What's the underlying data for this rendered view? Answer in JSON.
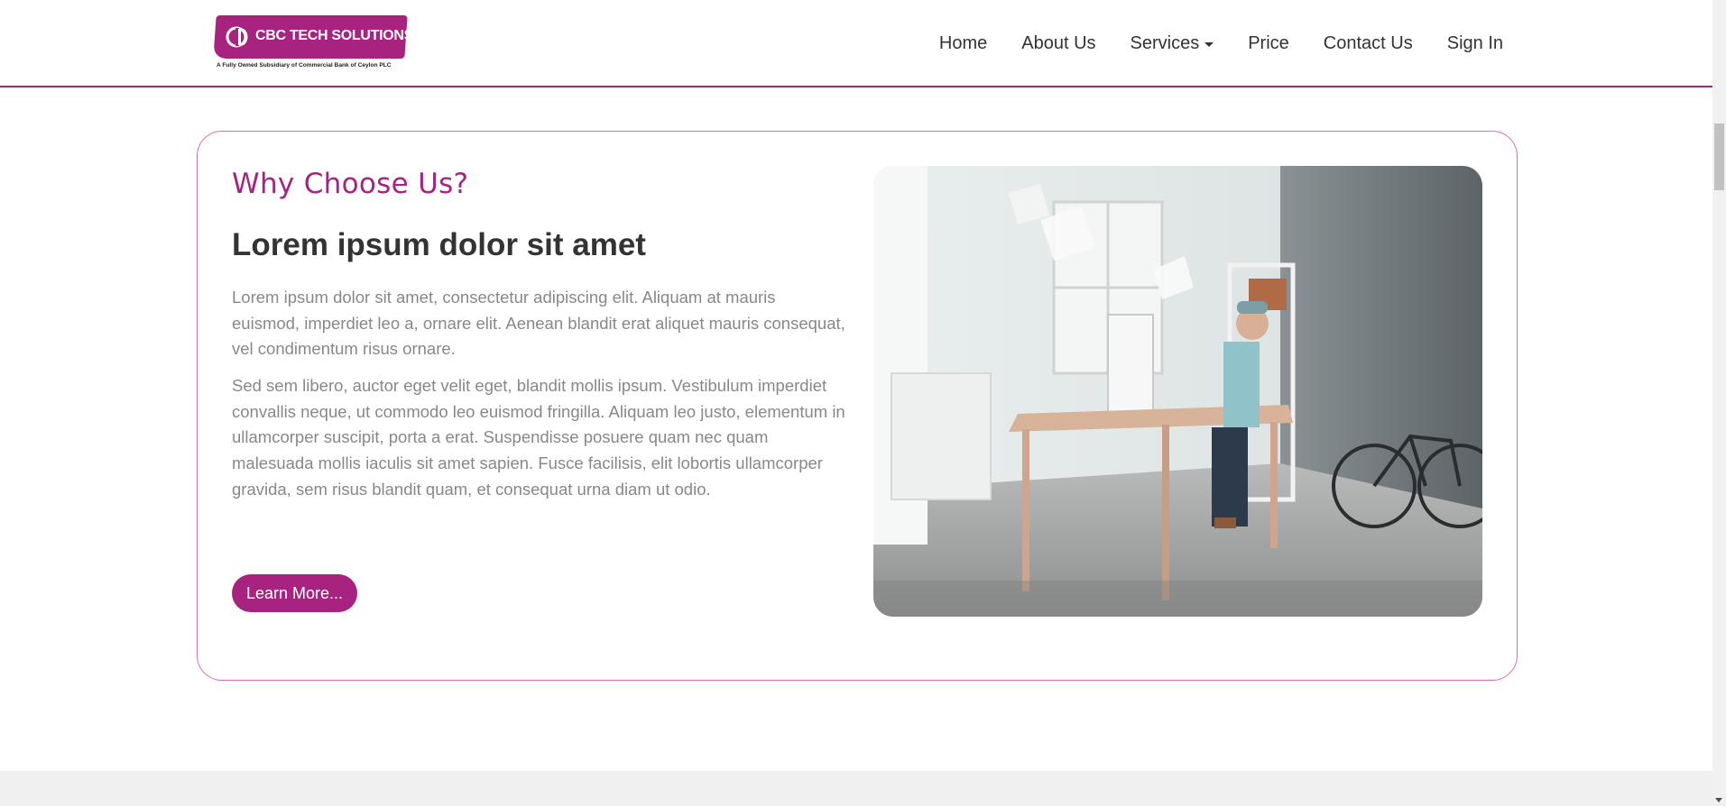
{
  "header": {
    "logo": {
      "name": "CBC TECH SOLUTIONS",
      "tagline": "A Fully Owned Subsidiary of Commercial Bank of Ceylon PLC"
    },
    "nav": {
      "home": "Home",
      "about": "About Us",
      "services": "Services",
      "price": "Price",
      "contact": "Contact Us",
      "signin": "Sign In"
    }
  },
  "section": {
    "eyebrow": "Why Choose Us?",
    "title": "Lorem ipsum dolor sit amet",
    "paragraph1": "Lorem ipsum dolor sit amet, consectetur adipiscing elit. Aliquam at mauris euismod, imperdiet leo a, ornare elit. Aenean blandit erat aliquet mauris consequat, vel condimentum risus ornare.",
    "paragraph2": "Sed sem libero, auctor eget velit eget, blandit mollis ipsum. Vestibulum imperdiet convallis neque, ut commodo leo euismod fringilla. Aliquam leo justo, elementum in ullamcorper suscipit, porta a erat. Suspendisse posuere quam nec quam malesuada mollis iaculis sit amet sapien. Fusce facilisis, elit lobortis ullamcorper gravida, sem risus blandit quam, et consequat urna diam ut odio.",
    "button": "Learn More...",
    "image_icon": "office-photo"
  },
  "icons": {
    "services_dropdown": "caret-down-icon",
    "scroll_down": "scroll-down-arrow-icon"
  },
  "colors": {
    "brand": "#a8237f",
    "border": "#d46fb5",
    "text": "#333333",
    "muted": "#888888",
    "footer_band": "#f0f0f0"
  }
}
